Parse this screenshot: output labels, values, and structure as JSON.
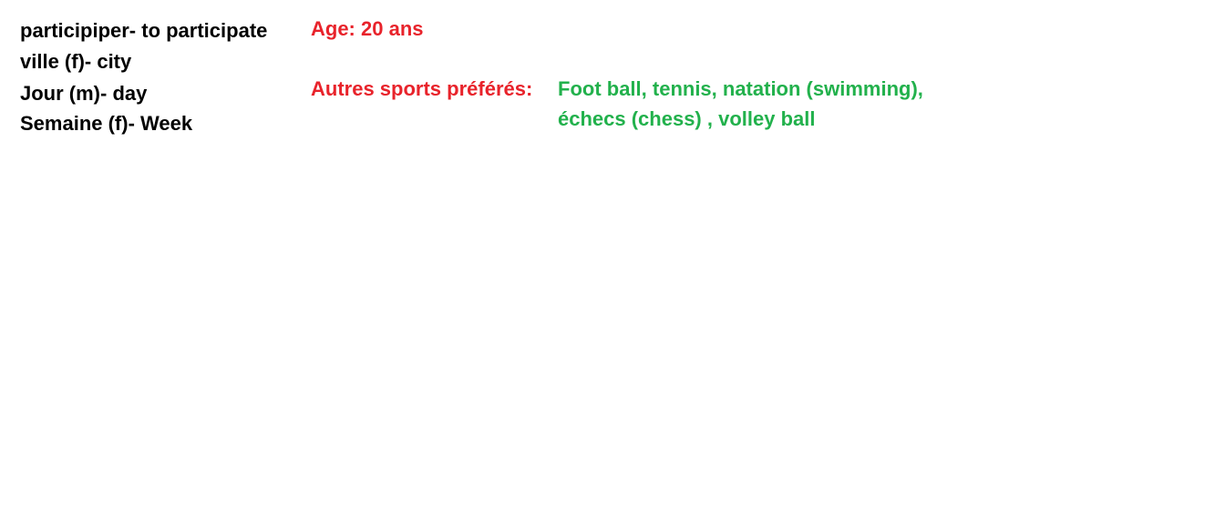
{
  "vocab": {
    "items": [
      "participiper- to participate",
      "ville (f)- city",
      "Jour (m)- day",
      "Semaine (f)- Week"
    ]
  },
  "profile": {
    "age": "Age: 20 ans",
    "sports_label": "Autres sports préférés:",
    "sports_line1": "Foot ball, tennis, natation (swimming),",
    "sports_line2": "échecs (chess) , volley ball"
  },
  "colors": {
    "text": "#000000",
    "label_red": "#e8232b",
    "value_green": "#22b14c",
    "background": "#ffffff"
  }
}
